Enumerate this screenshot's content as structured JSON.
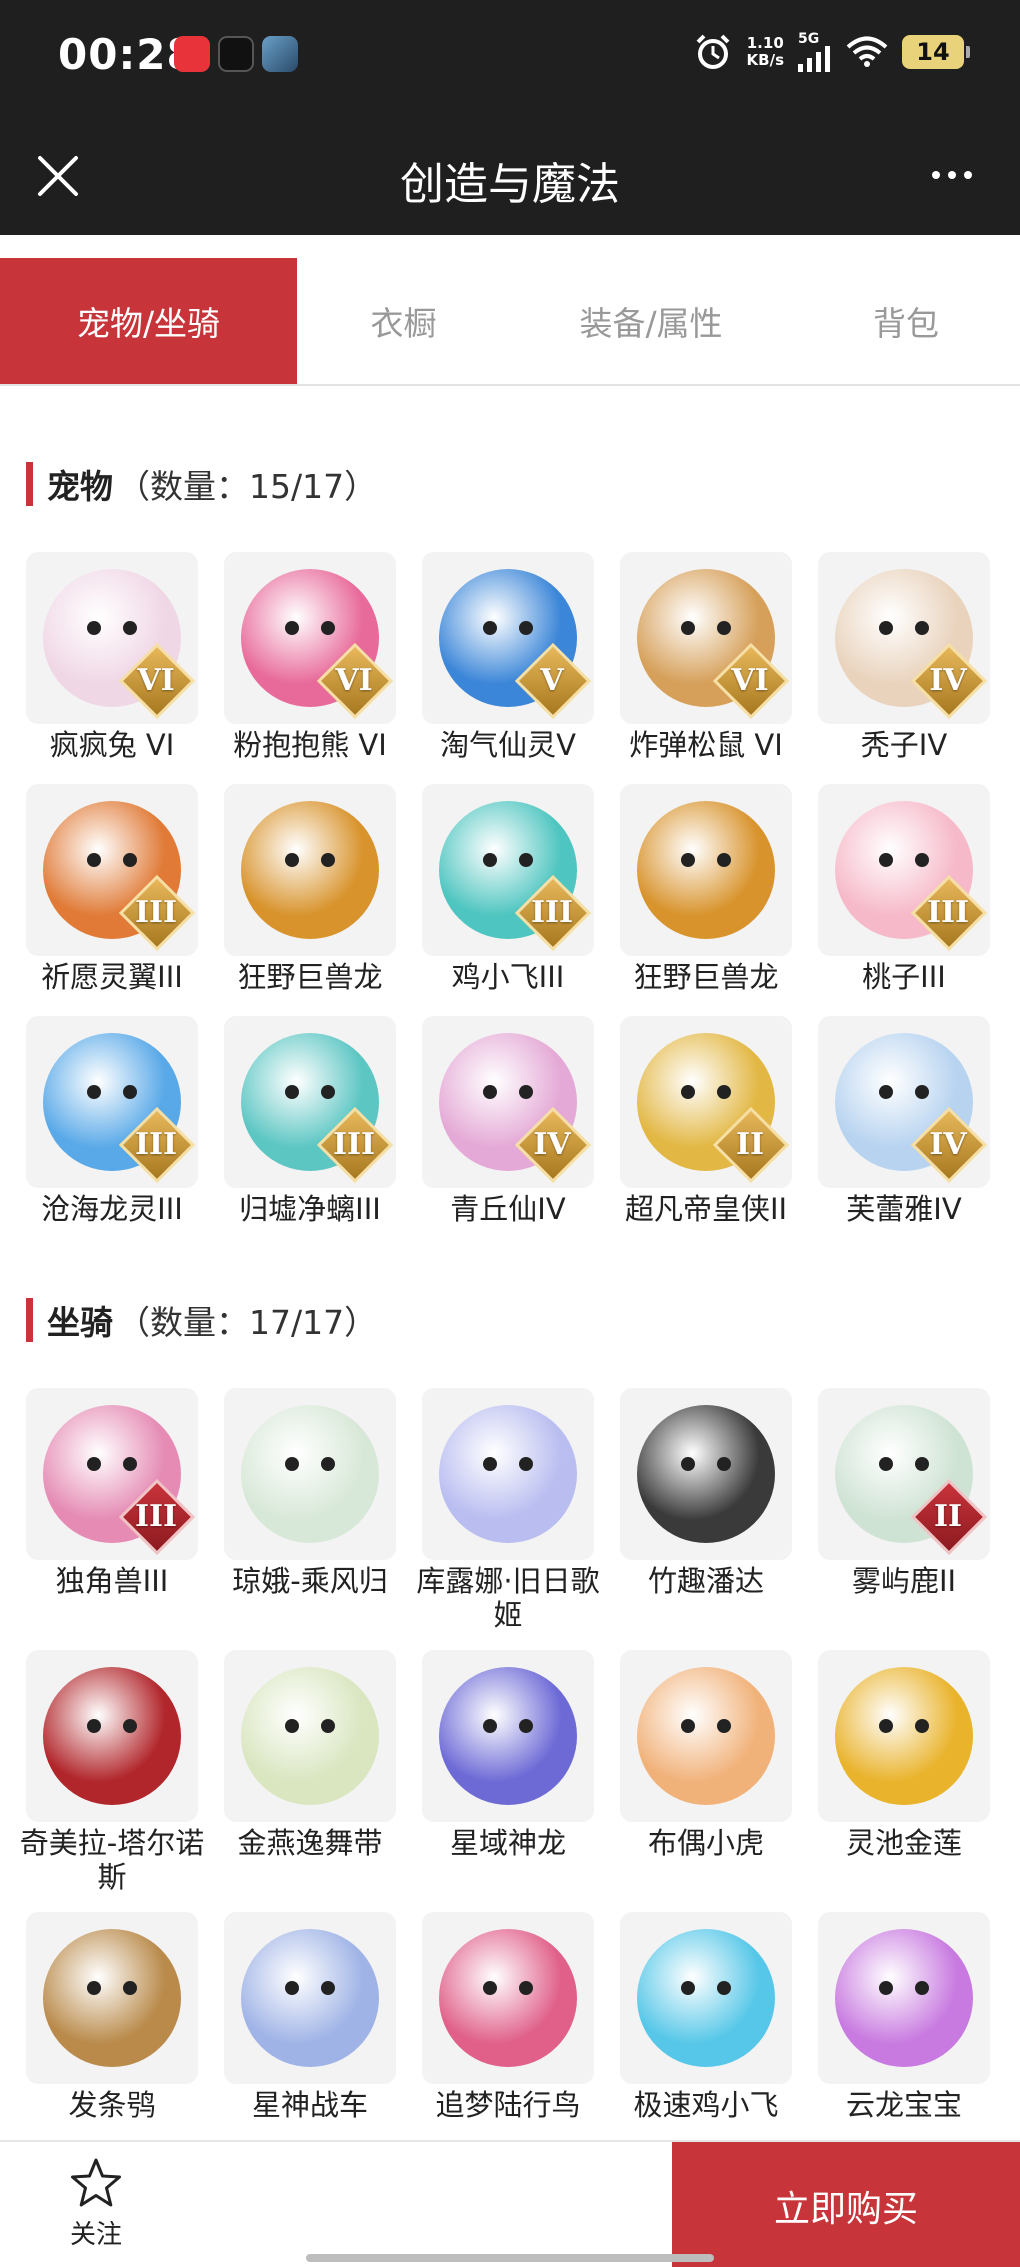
{
  "status_bar": {
    "time": "00:28",
    "net_speed": "1.10",
    "net_unit": "KB/s",
    "network_type": "5G",
    "battery": "14",
    "icons": [
      "netease-cloud-music-icon",
      "tiktok-icon",
      "game-app-icon",
      "alarm-icon",
      "signal-icon",
      "wifi-icon"
    ]
  },
  "header": {
    "title": "创造与魔法",
    "close_icon": "close-icon",
    "more_icon": "more-dots-icon"
  },
  "tabs": [
    {
      "label": "宠物/坐骑",
      "active": true
    },
    {
      "label": "衣橱",
      "active": false
    },
    {
      "label": "装备/属性",
      "active": false
    },
    {
      "label": "背包",
      "active": false
    }
  ],
  "pets_section": {
    "title": "宠物",
    "count": "（数量：15/17）",
    "items": [
      {
        "label": "疯疯兔 VI",
        "rank": "VI",
        "color": "#f0d7e6"
      },
      {
        "label": "粉抱抱熊 VI",
        "rank": "VI",
        "color": "#e86a9a"
      },
      {
        "label": "淘气仙灵V",
        "rank": "V",
        "color": "#3b86d8"
      },
      {
        "label": "炸弹松鼠 VI",
        "rank": "VI",
        "color": "#d6a05a"
      },
      {
        "label": "秃子IV",
        "rank": "IV",
        "color": "#e9d3bd"
      },
      {
        "label": "祈愿灵翼III",
        "rank": "III",
        "color": "#e07a36"
      },
      {
        "label": "狂野巨兽龙",
        "rank": "",
        "color": "#d8932c"
      },
      {
        "label": "鸡小飞III",
        "rank": "III",
        "color": "#4ec5c0"
      },
      {
        "label": "狂野巨兽龙",
        "rank": "",
        "color": "#d8932c"
      },
      {
        "label": "桃子III",
        "rank": "III",
        "color": "#f6b9c9"
      },
      {
        "label": "沧海龙灵III",
        "rank": "III",
        "color": "#59a9e8"
      },
      {
        "label": "归墟净螭III",
        "rank": "III",
        "color": "#5cc6c3"
      },
      {
        "label": "青丘仙IV",
        "rank": "IV",
        "color": "#e4a9d6"
      },
      {
        "label": "超凡帝皇侠II",
        "rank": "II",
        "color": "#e2b743"
      },
      {
        "label": "芙蕾雅IV",
        "rank": "IV",
        "color": "#b7d3f0"
      }
    ]
  },
  "mounts_section": {
    "title": "坐骑",
    "count": "（数量：17/17）",
    "items": [
      {
        "label": "独角兽III",
        "rank": "III",
        "rank_style": "red",
        "color": "#e58bb4"
      },
      {
        "label": "琼娥-乘风归",
        "rank": "",
        "color": "#d8e8d8"
      },
      {
        "label": "库露娜·旧日歌姬",
        "rank": "",
        "color": "#b9bdf0"
      },
      {
        "label": "竹趣潘达",
        "rank": "",
        "color": "#3a3a3a"
      },
      {
        "label": "雾屿鹿II",
        "rank": "II",
        "rank_style": "red",
        "color": "#cfe3d4"
      },
      {
        "label": "奇美拉-塔尔诺斯",
        "rank": "",
        "color": "#b1262b"
      },
      {
        "label": "金燕逸舞带",
        "rank": "",
        "color": "#d9e6c0"
      },
      {
        "label": "星域神龙",
        "rank": "",
        "color": "#6d6ad6"
      },
      {
        "label": "布偶小虎",
        "rank": "",
        "color": "#f1b27a"
      },
      {
        "label": "灵池金莲",
        "rank": "",
        "color": "#e9b32c"
      },
      {
        "label": "发条鸮",
        "rank": "",
        "color": "#b98a4a"
      },
      {
        "label": "星神战车",
        "rank": "",
        "color": "#9fb3e6"
      },
      {
        "label": "追梦陆行鸟",
        "rank": "",
        "color": "#e0608a"
      },
      {
        "label": "极速鸡小飞",
        "rank": "",
        "color": "#56c7e8"
      },
      {
        "label": "云龙宝宝",
        "rank": "",
        "color": "#c87ae0"
      }
    ]
  },
  "bottom_bar": {
    "follow_label": "关注",
    "follow_icon": "star-outline-icon",
    "buy_label": "立即购买"
  },
  "colors": {
    "accent": "#c7353b",
    "header_bg": "#1f1f1f",
    "tile_bg": "#f3f3f3"
  }
}
